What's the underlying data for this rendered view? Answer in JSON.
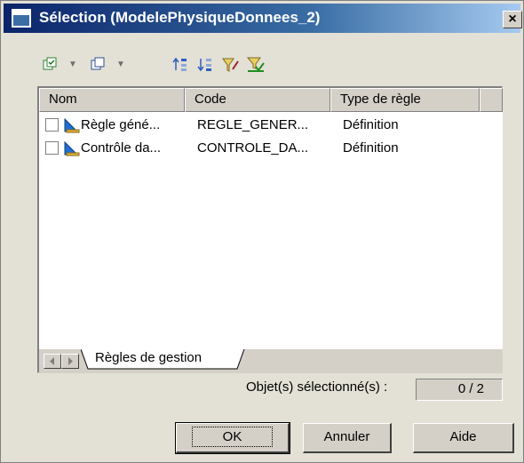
{
  "window": {
    "title": "Sélection (ModelePhysiqueDonnees_2)",
    "close_label": "×"
  },
  "toolbar": {
    "items": [
      {
        "icon": "select-all-icon",
        "has_dropdown": true
      },
      {
        "icon": "deselect-all-icon",
        "has_dropdown": true
      },
      {
        "icon": "move-to-top-icon"
      },
      {
        "icon": "move-to-bottom-icon"
      },
      {
        "icon": "filter-icon"
      },
      {
        "icon": "clear-filter-icon"
      }
    ]
  },
  "list": {
    "columns": [
      "Nom",
      "Code",
      "Type de règle"
    ],
    "rows": [
      {
        "checked": false,
        "icon": "business-rule-icon",
        "name": "Règle géné...",
        "code": "REGLE_GENER...",
        "type": "Définition"
      },
      {
        "checked": false,
        "icon": "business-rule-icon",
        "name": "Contrôle da...",
        "code": "CONTROLE_DA...",
        "type": "Définition"
      }
    ],
    "tab_label": "Règles de gestion"
  },
  "status": {
    "selected_label": "Objet(s) sélectionné(s) :",
    "selected_value": "0 / 2"
  },
  "buttons": {
    "ok": "OK",
    "cancel": "Annuler",
    "help": "Aide"
  },
  "colors": {
    "titlebar_start": "#0a246a",
    "titlebar_end": "#a6caf0",
    "face": "#d4d0c8"
  }
}
